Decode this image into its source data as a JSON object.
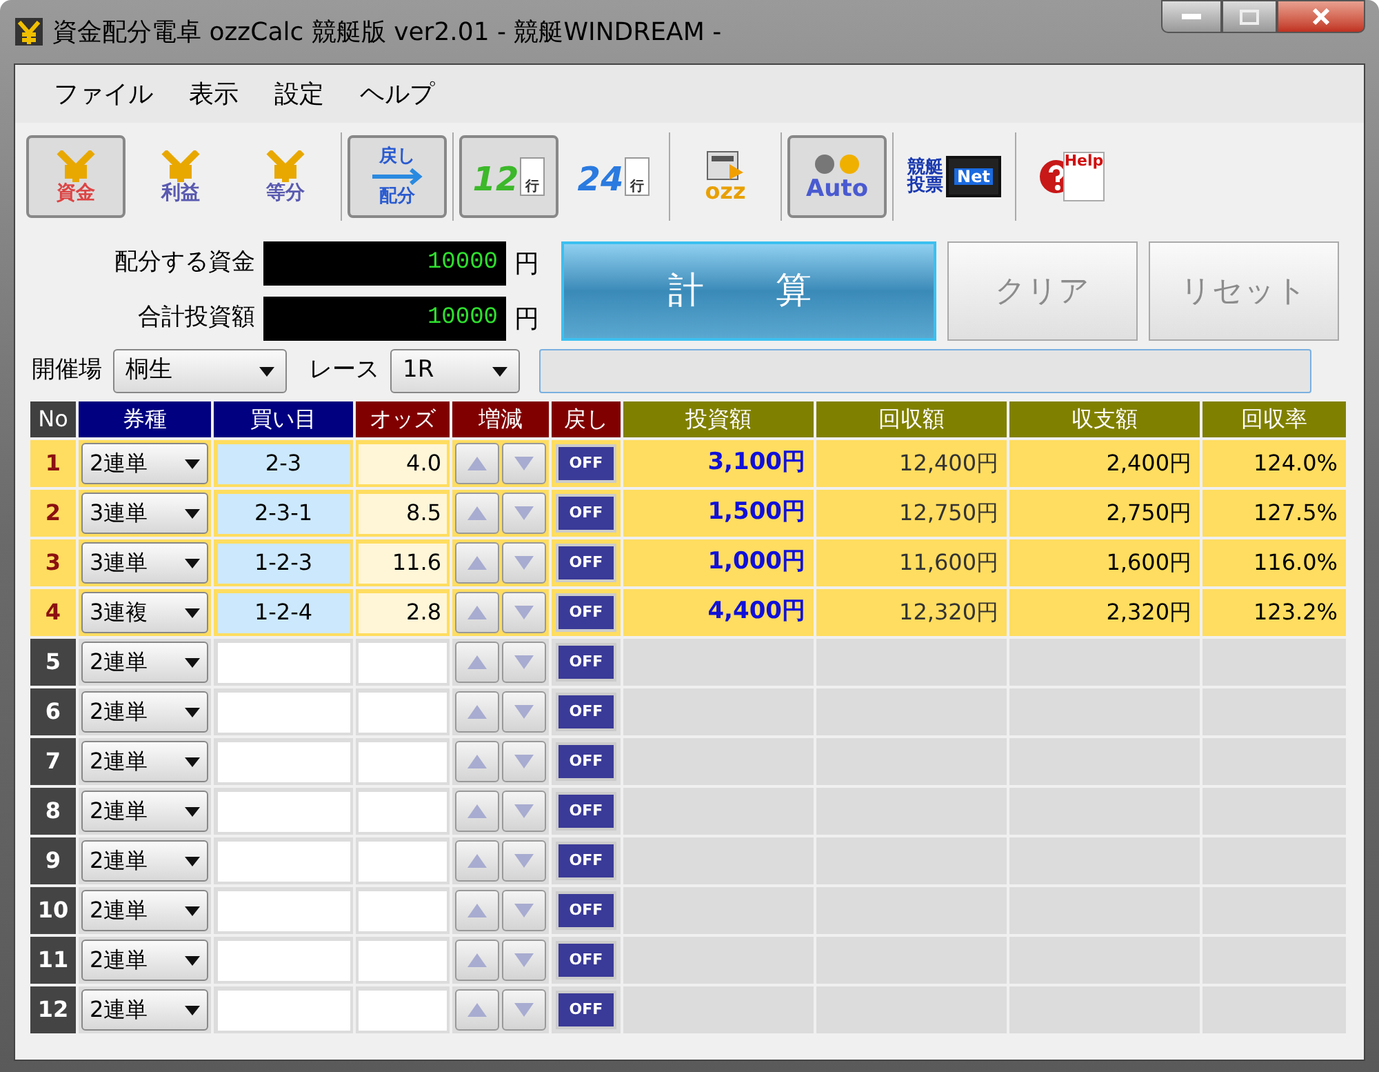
{
  "window": {
    "title": "資金配分電卓 ozzCalc 競艇版 ver2.01 - 競艇WINDREAM -"
  },
  "menu": [
    "ファイル",
    "表示",
    "設定",
    "ヘルプ"
  ],
  "toolbar": [
    {
      "kind": "yen",
      "labels": [
        "資金"
      ],
      "selected": true,
      "separator_after": false
    },
    {
      "kind": "yen",
      "labels": [
        "利益"
      ],
      "selected": false,
      "separator_after": false
    },
    {
      "kind": "yen",
      "labels": [
        "等分"
      ],
      "selected": false,
      "separator_after": true
    },
    {
      "kind": "arrows",
      "labels": [
        "戻し",
        "配分"
      ],
      "selected": true,
      "separator_after": true
    },
    {
      "kind": "rows",
      "labels": [
        "12",
        "行"
      ],
      "selected": true,
      "separator_after": false
    },
    {
      "kind": "rows",
      "labels": [
        "24",
        "行"
      ],
      "selected": false,
      "separator_after": true
    },
    {
      "kind": "ozz",
      "labels": [
        "ozz"
      ],
      "selected": false,
      "separator_after": true
    },
    {
      "kind": "auto",
      "labels": [
        "Auto"
      ],
      "selected": true,
      "separator_after": true
    },
    {
      "kind": "net",
      "labels": [
        "競艇",
        "投票",
        "Net"
      ],
      "selected": false,
      "separator_after": true
    },
    {
      "kind": "help",
      "labels": [
        "Help"
      ],
      "selected": false,
      "separator_after": false
    }
  ],
  "form": {
    "fund": {
      "label": "配分する資金",
      "value": "10000",
      "unit": "円"
    },
    "total": {
      "label": "合計投資額",
      "value": "10000",
      "unit": "円"
    },
    "venue": {
      "label": "開催場",
      "value": "桐生"
    },
    "race": {
      "label": "レース",
      "value": "1R"
    },
    "buttons": [
      {
        "label": "計　算",
        "disabled": false
      },
      {
        "label": "クリア",
        "disabled": true
      },
      {
        "label": "リセット",
        "disabled": true
      }
    ]
  },
  "table": {
    "columns": [
      {
        "label": "No",
        "color": "#404040"
      },
      {
        "label": "券種",
        "color": "#000080"
      },
      {
        "label": "買い目",
        "color": "#000080"
      },
      {
        "label": "オッズ",
        "color": "#800000"
      },
      {
        "label": "増減",
        "color": "#800000"
      },
      {
        "label": "戻し",
        "color": "#800000"
      },
      {
        "label": "投資額",
        "color": "#808000"
      },
      {
        "label": "回収額",
        "color": "#808000"
      },
      {
        "label": "収支額",
        "color": "#808000"
      },
      {
        "label": "回収率",
        "color": "#808000"
      }
    ],
    "rows": [
      {
        "no": "1",
        "type": "2連単",
        "bet": "2-3",
        "odds": "4.0",
        "toggle": "OFF",
        "investment": "3,100円",
        "return": "12,400円",
        "balance": "2,400円",
        "rate": "124.0%",
        "active": true
      },
      {
        "no": "2",
        "type": "3連単",
        "bet": "2-3-1",
        "odds": "8.5",
        "toggle": "OFF",
        "investment": "1,500円",
        "return": "12,750円",
        "balance": "2,750円",
        "rate": "127.5%",
        "active": true
      },
      {
        "no": "3",
        "type": "3連単",
        "bet": "1-2-3",
        "odds": "11.6",
        "toggle": "OFF",
        "investment": "1,000円",
        "return": "11,600円",
        "balance": "1,600円",
        "rate": "116.0%",
        "active": true
      },
      {
        "no": "4",
        "type": "3連複",
        "bet": "1-2-4",
        "odds": "2.8",
        "toggle": "OFF",
        "investment": "4,400円",
        "return": "12,320円",
        "balance": "2,320円",
        "rate": "123.2%",
        "active": true
      },
      {
        "no": "5",
        "type": "2連単",
        "toggle": "OFF",
        "active": false
      },
      {
        "no": "6",
        "type": "2連単",
        "toggle": "OFF",
        "active": false
      },
      {
        "no": "7",
        "type": "2連単",
        "toggle": "OFF",
        "active": false
      },
      {
        "no": "8",
        "type": "2連単",
        "toggle": "OFF",
        "active": false
      },
      {
        "no": "9",
        "type": "2連単",
        "toggle": "OFF",
        "active": false
      },
      {
        "no": "10",
        "type": "2連単",
        "toggle": "OFF",
        "active": false
      },
      {
        "no": "11",
        "type": "2連単",
        "toggle": "OFF",
        "active": false
      },
      {
        "no": "12",
        "type": "2連単",
        "toggle": "OFF",
        "active": false
      }
    ]
  }
}
